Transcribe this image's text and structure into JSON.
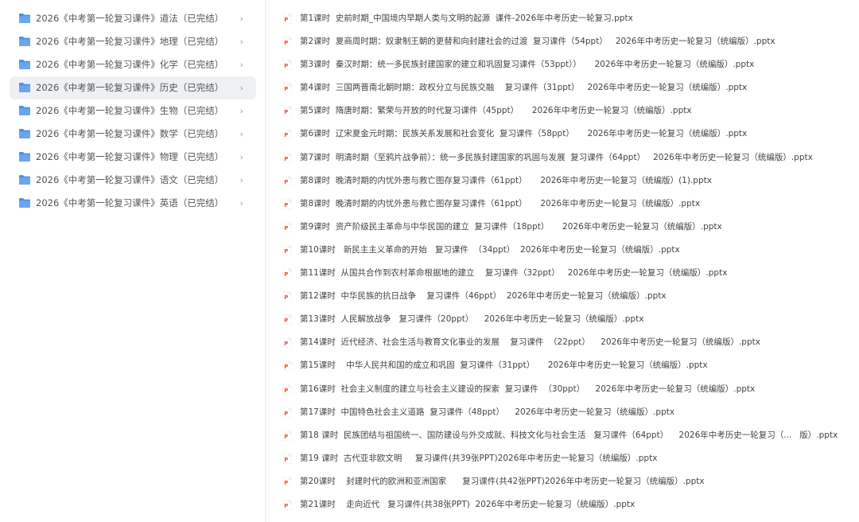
{
  "colors": {
    "folder_icon": "#4a8fe7",
    "ppt_icon": "#e8553a",
    "selected_bg": "#eef0f3",
    "text": "#444444"
  },
  "sidebar": {
    "items": [
      {
        "label": "2026《中考第一轮复习课件》道法（已完结）",
        "icon": "folder-icon",
        "selected": false
      },
      {
        "label": "2026《中考第一轮复习课件》地理（已完结）",
        "icon": "folder-icon",
        "selected": false
      },
      {
        "label": "2026《中考第一轮复习课件》化学（已完结）",
        "icon": "folder-icon",
        "selected": false
      },
      {
        "label": "2026《中考第一轮复习课件》历史（已完结）",
        "icon": "folder-icon",
        "selected": true
      },
      {
        "label": "2026《中考第一轮复习课件》生物（已完结）",
        "icon": "folder-icon",
        "selected": false
      },
      {
        "label": "2026《中考第一轮复习课件》数学（已完结）",
        "icon": "folder-icon",
        "selected": false
      },
      {
        "label": "2026《中考第一轮复习课件》物理（已完结）",
        "icon": "folder-icon",
        "selected": false
      },
      {
        "label": "2026《中考第一轮复习课件》语文（已完结）",
        "icon": "folder-icon",
        "selected": false
      },
      {
        "label": "2026《中考第一轮复习课件》英语（已完结）",
        "icon": "folder-icon",
        "selected": false
      }
    ],
    "chevron": "›"
  },
  "files": [
    {
      "name": "第1课时  史前时期_中国境内早期人类与文明的起源  课件-2026年中考历史一轮复习.pptx"
    },
    {
      "name": "第2课时  夏商周时期：奴隶制王朝的更替和向封建社会的过渡  复习课件（54ppt）   2026年中考历史一轮复习（统编版）.pptx"
    },
    {
      "name": "第3课时  秦汉时期：统一多民族封建国家的建立和巩固复习课件（53ppt））     2026年中考历史一轮复习（统编版）.pptx"
    },
    {
      "name": "第4课时  三国两晋南北朝时期：政权分立与民族交融    复习课件（31ppt）   2026年中考历史一轮复习（统编版）.pptx"
    },
    {
      "name": "第5课时  隋唐时期：繁荣与开放的时代复习课件（45ppt）     2026年中考历史一轮复习（统编版）.pptx"
    },
    {
      "name": "第6课时  辽宋夏金元时期：民族关系发展和社会变化  复习课件（58ppt）     2026年中考历史一轮复习（统编版）.pptx"
    },
    {
      "name": "第7课时  明清时期（至鸦片战争前）：统一多民族封建国家的巩固与发展  复习课件（64ppt）   2026年中考历史一轮复习（统编版）.pptx"
    },
    {
      "name": "第8课时  晚清时期的内忧外患与救亡图存复习课件（61ppt）     2026年中考历史一轮复习（统编版）(1).pptx"
    },
    {
      "name": "第8课时  晚清时期的内忧外患与救亡图存复习课件（61ppt）     2026年中考历史一轮复习（统编版）.pptx"
    },
    {
      "name": "第9课时  资产阶级民主革命与中华民国的建立  复习课件（18ppt）     2026年中考历史一轮复习（统编版）.pptx"
    },
    {
      "name": "第10课时   新民主主义革命的开始   复习课件  （34ppt）  2026年中考历史一轮复习（统编版）.pptx"
    },
    {
      "name": "第11课时  从国共合作到农村革命根据地的建立    复习课件（32ppt）   2026年中考历史一轮复习（统编版）.pptx"
    },
    {
      "name": "第12课时  中华民族的抗日战争    复习课件（46ppt）  2026年中考历史一轮复习（统编版）.pptx"
    },
    {
      "name": "第13课时  人民解放战争   复习课件（20ppt）    2026年中考历史一轮复习（统编版）.pptx"
    },
    {
      "name": "第14课时  近代经济、社会生活与教育文化事业的发展    复习课件  （22ppt）    2026年中考历史一轮复习（统编版）.pptx"
    },
    {
      "name": "第15课时    中华人民共和国的成立和巩固  复习课件（31ppt）     2026年中考历史一轮复习（统编版）.pptx"
    },
    {
      "name": "第16课时  社会主义制度的建立与社会主义建设的探索  复习课件  （30ppt）    2026年中考历史一轮复习（统编版）.pptx"
    },
    {
      "name": "第17课时  中国特色社会主义道路  复习课件（48ppt）    2026年中考历史一轮复习（统编版）.pptx"
    },
    {
      "name": "第18 课时  民族团结与祖国统一、国防建设与外交成就、科技文化与社会生活   复习课件（64ppt）    2026年中考历史一轮复习（...   版）.pptx"
    },
    {
      "name": "第19 课时  古代亚非欧文明     复习课件(共39张PPT)2026年中考历史一轮复习（统编版）.pptx"
    },
    {
      "name": "第20课时    封建时代的欧洲和亚洲国家      复习课件(共42张PPT)2026年中考历史一轮复习（统编版）.pptx"
    },
    {
      "name": "第21课时    走向近代   复习课件(共38张PPT)  2026年中考历史一轮复习（统编版）.pptx"
    }
  ]
}
